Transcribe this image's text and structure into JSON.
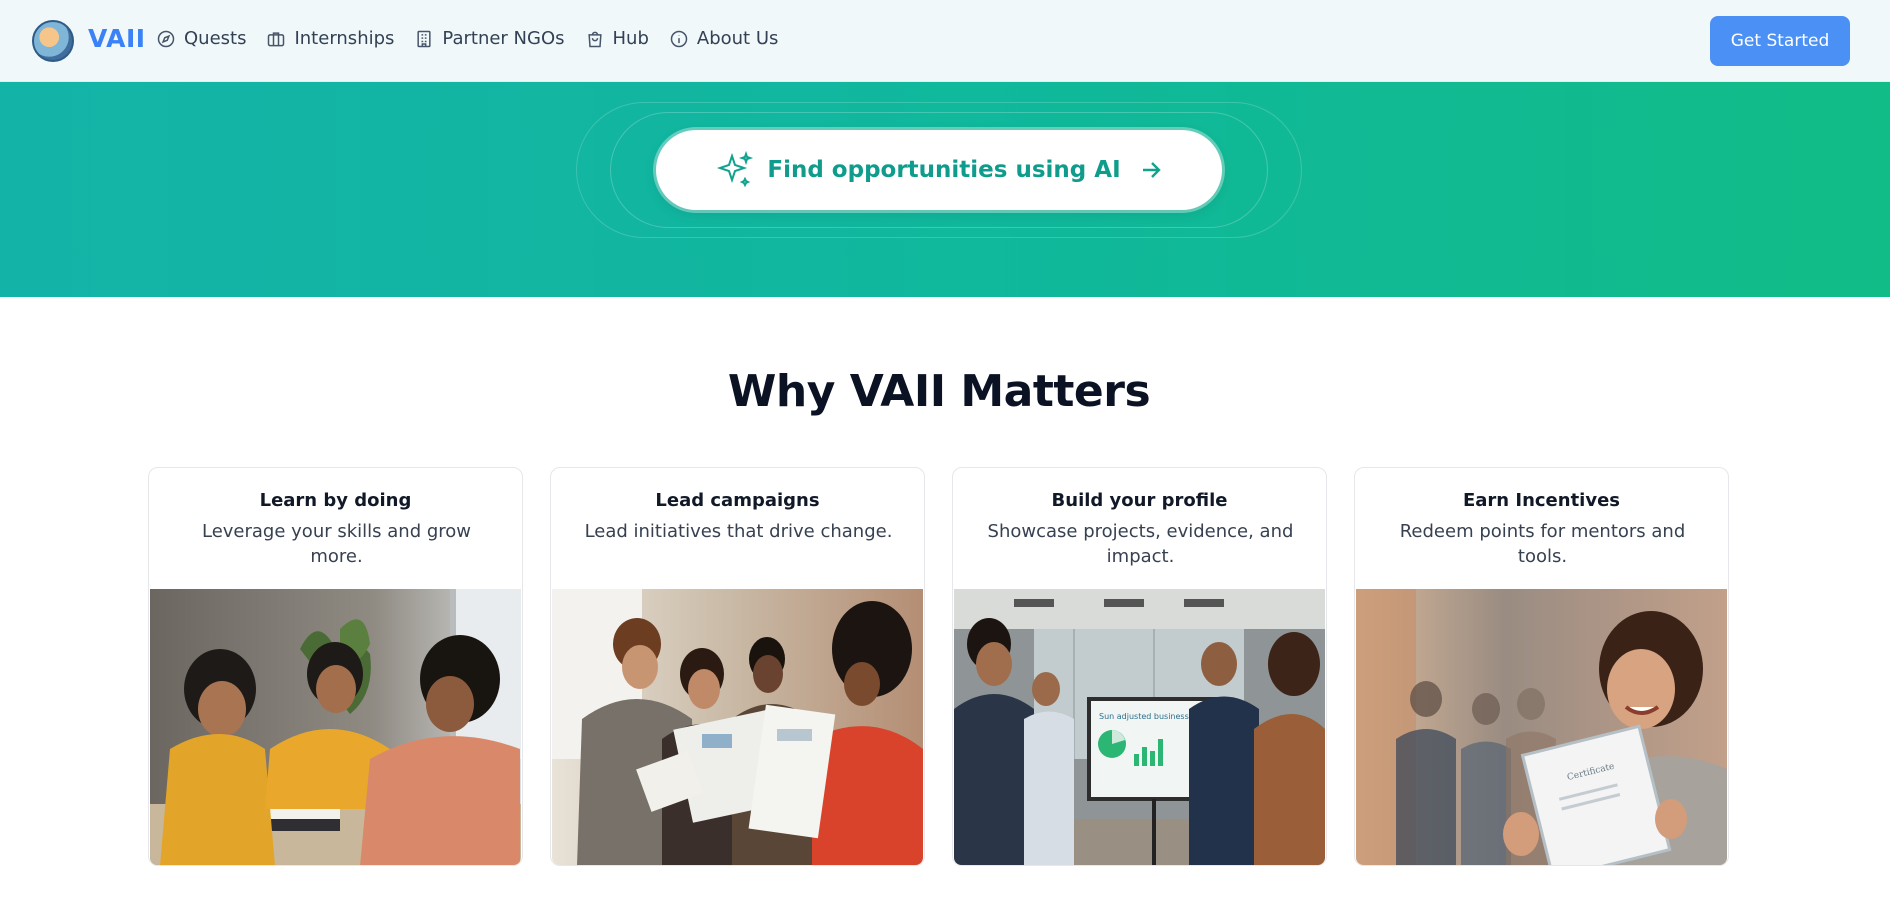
{
  "nav": {
    "brand": "VAII",
    "items": [
      {
        "label": "Quests",
        "icon": "compass-icon"
      },
      {
        "label": "Internships",
        "icon": "briefcase-icon"
      },
      {
        "label": "Partner NGOs",
        "icon": "building-icon"
      },
      {
        "label": "Hub",
        "icon": "shopping-bag-icon"
      },
      {
        "label": "About Us",
        "icon": "info-icon"
      }
    ],
    "cta": "Get Started"
  },
  "hero": {
    "ai_button_label": "Find opportunities using AI",
    "ai_button_icons": [
      "sparkle-icon",
      "arrow-right-icon"
    ]
  },
  "section": {
    "title": "Why VAII Matters",
    "cards": [
      {
        "title": "Learn by doing",
        "description": "Leverage your skills and grow more.",
        "image": "students studying at a table"
      },
      {
        "title": "Lead campaigns",
        "description": "Lead initiatives that drive change.",
        "image": "group reviewing flyers"
      },
      {
        "title": "Build your profile",
        "description": "Showcase projects, evidence, and impact.",
        "image": "team presenting charts on a screen"
      },
      {
        "title": "Earn Incentives",
        "description": "Redeem points for mentors and tools.",
        "image": "smiling girl holding certificate"
      }
    ],
    "screen_text": "Sun adjusted business",
    "certificate_text": "Certificate"
  },
  "colors": {
    "brand": "#3b82f6",
    "cta": "#4a90f5",
    "hero_start": "#14b3a8",
    "hero_end": "#12bc87",
    "ai_text": "#0f9c8c"
  }
}
